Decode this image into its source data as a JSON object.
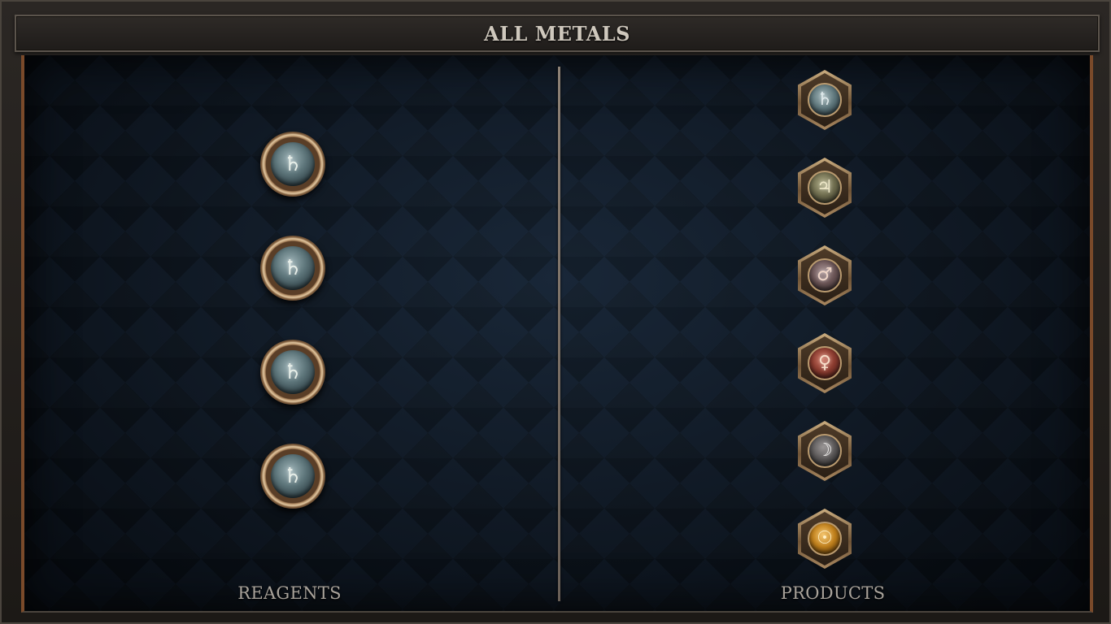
{
  "window": {
    "title": "ALL METALS"
  },
  "reagents": {
    "label": "REAGENTS",
    "items": [
      {
        "symbol": "♄",
        "metal_icon": "lead-saturn-icon",
        "color": "#5f777c"
      },
      {
        "symbol": "♄",
        "metal_icon": "lead-saturn-icon",
        "color": "#5f777c"
      },
      {
        "symbol": "♄",
        "metal_icon": "lead-saturn-icon",
        "color": "#5f777c"
      },
      {
        "symbol": "♄",
        "metal_icon": "lead-saturn-icon",
        "color": "#5f777c"
      }
    ]
  },
  "products": {
    "label": "PRODUCTS",
    "items": [
      {
        "symbol": "♄",
        "metal_icon": "lead-saturn-icon",
        "color": "#5f777c",
        "glyph_color": "#dfe9ea"
      },
      {
        "symbol": "♃",
        "metal_icon": "tin-jupiter-icon",
        "color": "#6e6c4e",
        "glyph_color": "#efe8c8"
      },
      {
        "symbol": "♂",
        "metal_icon": "iron-mars-icon",
        "color": "#6b5556",
        "glyph_color": "#f0d6c8"
      },
      {
        "symbol": "♀",
        "metal_icon": "copper-venus-icon",
        "color": "#8a3b2f",
        "glyph_color": "#f6ddc8"
      },
      {
        "symbol": "☽",
        "metal_icon": "silver-moon-icon",
        "color": "#5b5858",
        "glyph_color": "#f2f0ee"
      },
      {
        "symbol": "☉",
        "metal_icon": "gold-sun-icon",
        "color": "#c0801c",
        "glyph_color": "#fff1c6"
      }
    ]
  },
  "colors": {
    "background": "#142030",
    "frame": "#2b2724",
    "accent_border": "#7a4a2a",
    "label_text": "#a9a39b",
    "title_text": "#cfc8bd"
  }
}
